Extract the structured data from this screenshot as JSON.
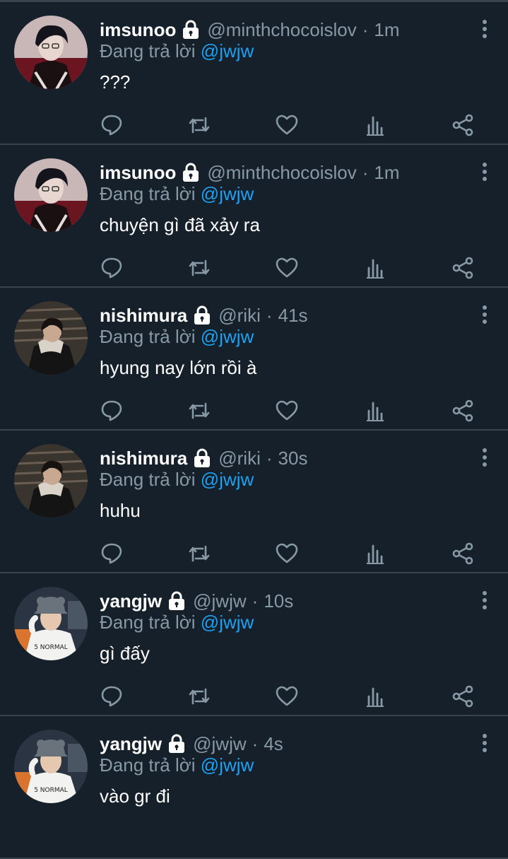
{
  "colors": {
    "background": "#15202b",
    "divider": "#38444d",
    "secondary_text": "#8899a6",
    "accent": "#1da1f2",
    "primary_text": "#ffffff"
  },
  "icons": {
    "lock": "lock-icon",
    "more": "more-vertical-icon",
    "reply": "reply-icon",
    "retweet": "retweet-icon",
    "like": "heart-icon",
    "analytics": "analytics-icon",
    "share": "share-icon"
  },
  "tweets": [
    {
      "display_name": "imsunoo",
      "handle": "@minthchocoislov",
      "dot": "·",
      "time": "1m",
      "reply_prefix": "Đang trả lời",
      "reply_to": "@jwjw",
      "text": "???"
    },
    {
      "display_name": "imsunoo",
      "handle": "@minthchocoislov",
      "dot": "·",
      "time": "1m",
      "reply_prefix": "Đang trả lời",
      "reply_to": "@jwjw",
      "text": "chuyện gì đã xảy ra"
    },
    {
      "display_name": "nishimura",
      "handle": "@riki",
      "dot": "·",
      "time": "41s",
      "reply_prefix": "Đang trả lời",
      "reply_to": "@jwjw",
      "text": "hyung nay lớn rồi à"
    },
    {
      "display_name": "nishimura",
      "handle": "@riki",
      "dot": "·",
      "time": "30s",
      "reply_prefix": "Đang trả lời",
      "reply_to": "@jwjw",
      "text": "huhu"
    },
    {
      "display_name": "yangjw",
      "handle": "@jwjw",
      "dot": "·",
      "time": "10s",
      "reply_prefix": "Đang trả lời",
      "reply_to": "@jwjw",
      "text": "gì đấy"
    },
    {
      "display_name": "yangjw",
      "handle": "@jwjw",
      "dot": "·",
      "time": "4s",
      "reply_prefix": "Đang trả lời",
      "reply_to": "@jwjw",
      "text": "vào gr đi"
    }
  ]
}
